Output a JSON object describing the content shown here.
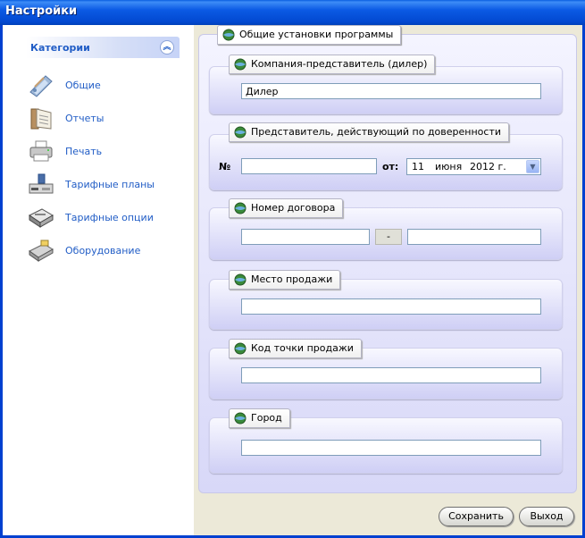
{
  "window": {
    "title": "Настройки"
  },
  "sidebar": {
    "header": "Категории",
    "items": [
      {
        "label": "Общие",
        "icon": "general-settings-icon"
      },
      {
        "label": "Отчеты",
        "icon": "reports-icon"
      },
      {
        "label": "Печать",
        "icon": "printer-icon"
      },
      {
        "label": "Тарифные планы",
        "icon": "tariff-plans-icon"
      },
      {
        "label": "Тарифные опции",
        "icon": "tariff-options-icon"
      },
      {
        "label": "Оборудование",
        "icon": "equipment-icon"
      }
    ]
  },
  "main": {
    "title": "Общие установки программы",
    "dealer": {
      "label": "Компания-представитель (дилер)",
      "value": "Дилер"
    },
    "representative": {
      "label": "Представитель, действующий по доверенности",
      "number_label": "№",
      "number_value": "",
      "date_label": "от:",
      "date": {
        "day": "11",
        "month": "июня",
        "year": "2012 г."
      }
    },
    "contract": {
      "label": "Номер договора",
      "separator": "-",
      "part1": "",
      "part2": ""
    },
    "sale_place": {
      "label": "Место продажи",
      "value": ""
    },
    "sale_point_code": {
      "label": "Код точки продажи",
      "value": ""
    },
    "city": {
      "label": "Город",
      "value": ""
    }
  },
  "buttons": {
    "save": "Сохранить",
    "exit": "Выход"
  },
  "colors": {
    "titlebar": "#0b5ae4",
    "accent": "#215dc6",
    "panel": "#d8d8f8"
  }
}
